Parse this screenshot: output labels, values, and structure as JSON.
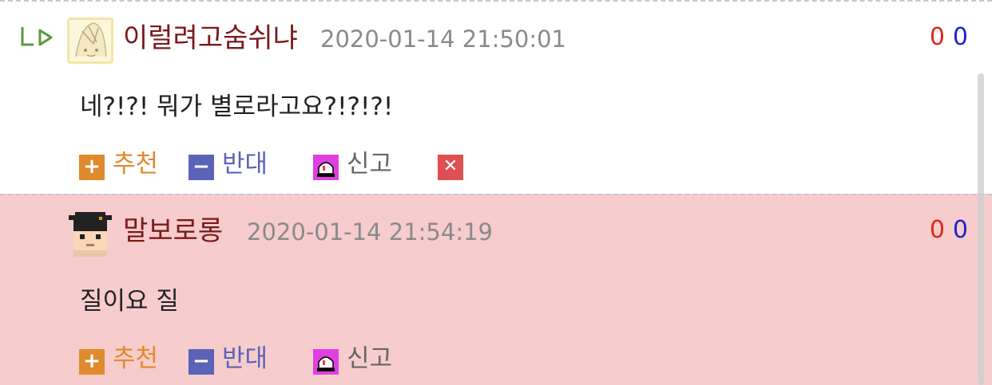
{
  "colors": {
    "author": "#7a1a1a",
    "date": "#8a8a8a",
    "recommend": "#e08a2e",
    "oppose": "#5b63b8",
    "report_icon": "#e040e0",
    "delete_icon": "#e05050",
    "vote_up": "#e0261b",
    "vote_down": "#1b22d0",
    "highlight_bg": "#f6cccc"
  },
  "comments": [
    {
      "is_reply": true,
      "reply_icon": "reply-arrow-icon",
      "avatar": "avatar-illustration",
      "author": "이럴려고숨쉬냐",
      "date": "2020-01-14 21:50:01",
      "vote_up": "0",
      "vote_down": "0",
      "text": "네?!?! 뭐가 별로라고요?!?!?!",
      "actions": {
        "recommend_icon": "plus-icon",
        "recommend": "추천",
        "oppose_icon": "minus-icon",
        "oppose": "반대",
        "report_icon": "siren-icon",
        "report": "신고",
        "delete_icon": "close-icon"
      }
    },
    {
      "is_reply": false,
      "avatar": "avatar-pixel-graduate",
      "author": "말보로롱",
      "date": "2020-01-14 21:54:19",
      "vote_up": "0",
      "vote_down": "0",
      "text": "질이요 질",
      "actions": {
        "recommend_icon": "plus-icon",
        "recommend": "추천",
        "oppose_icon": "minus-icon",
        "oppose": "반대",
        "report_icon": "siren-icon",
        "report": "신고"
      }
    }
  ]
}
